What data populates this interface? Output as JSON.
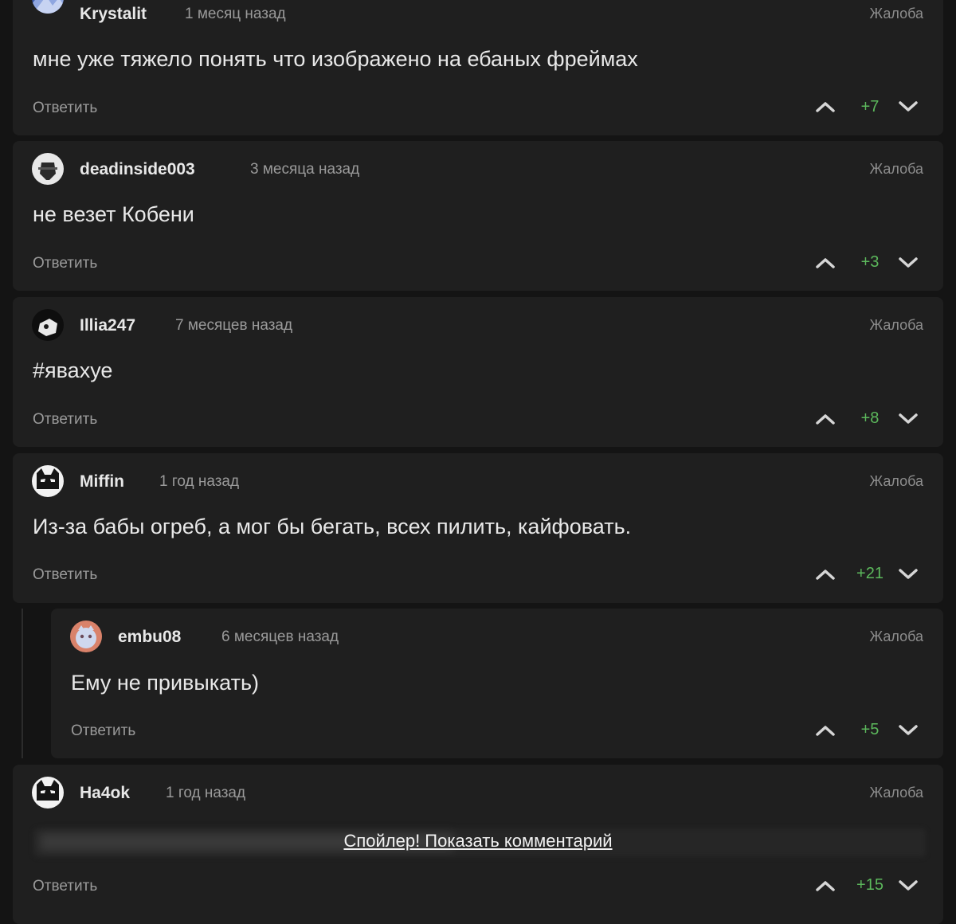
{
  "comments": [
    {
      "username": "Krystalit",
      "time": "1 месяц назад",
      "text": "мне уже тяжело понять что изображено на ебаных фреймах",
      "reply_label": "Ответить",
      "complaint_label": "Жалоба",
      "score": "+7"
    },
    {
      "username": "deadinside003",
      "time": "3 месяца назад",
      "text": "не везет Кобени",
      "reply_label": "Ответить",
      "complaint_label": "Жалоба",
      "score": "+3"
    },
    {
      "username": "Illia247",
      "time": "7 месяцев назад",
      "text": "#явахуе",
      "reply_label": "Ответить",
      "complaint_label": "Жалоба",
      "score": "+8"
    },
    {
      "username": "Miffin",
      "time": "1 год назад",
      "text": "Из-за бабы огреб, а мог бы бегать, всех пилить, кайфовать.",
      "reply_label": "Ответить",
      "complaint_label": "Жалоба",
      "score": "+21"
    },
    {
      "username": "embu08",
      "time": "6 месяцев назад",
      "text": "Ему не привыкать)",
      "reply_label": "Ответить",
      "complaint_label": "Жалоба",
      "score": "+5"
    },
    {
      "username": "Ha4ok",
      "time": "1 год назад",
      "spoiler_label": "Спойлер! Показать комментарий",
      "reply_label": "Ответить",
      "complaint_label": "Жалоба",
      "score": "+15"
    }
  ],
  "icons": {
    "vote_up": "chevron-up-icon",
    "vote_down": "chevron-down-icon"
  },
  "colors": {
    "background": "#141414",
    "card": "#1f1f1f",
    "score_positive": "#5cb85c",
    "muted_text": "#9a9a9a"
  }
}
